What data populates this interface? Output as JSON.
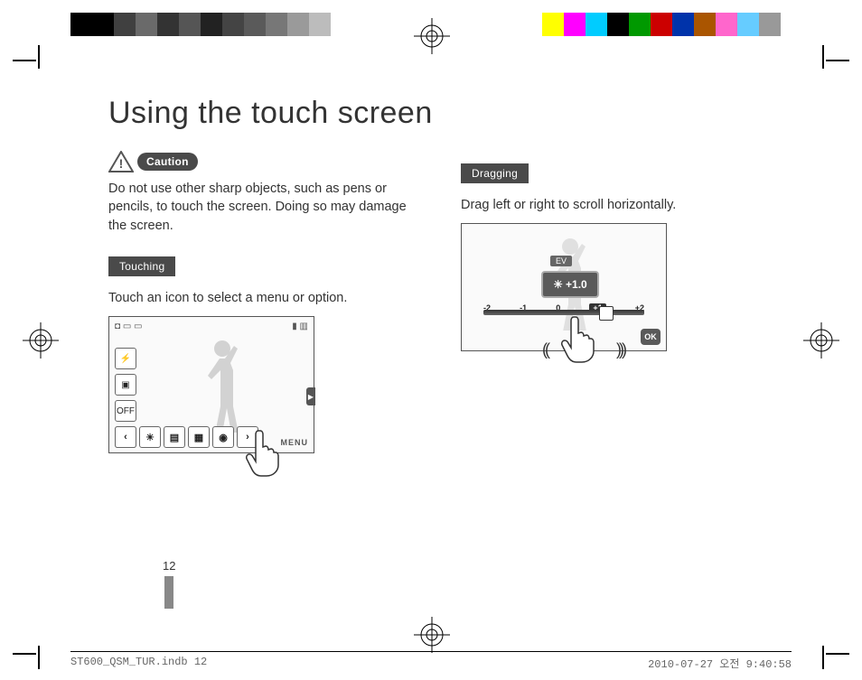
{
  "title": "Using the touch screen",
  "caution": {
    "badge": "Caution",
    "text": "Do not use other sharp objects, such as pens or pencils, to touch the screen. Doing so may damage the screen."
  },
  "sections": {
    "touching": {
      "label": "Touching",
      "text": "Touch an icon to select a menu or option."
    },
    "dragging": {
      "label": "Dragging",
      "text": "Drag left or right to scroll horizontally."
    }
  },
  "illustration_touching": {
    "menu_label": "MENU",
    "side_icons_bottom": "OFF"
  },
  "illustration_dragging": {
    "ev_title": "EV",
    "ev_value": "+1.0",
    "ticks": [
      "-2",
      "-1",
      "0",
      "+1",
      "+2"
    ],
    "ok_label": "OK"
  },
  "page_number": "12",
  "footer": {
    "file": "ST600_QSM_TUR.indb   12",
    "timestamp": "2010-07-27   오전 9:40:58"
  },
  "colorbar_left": [
    "#000",
    "#000",
    "#404040",
    "#6a6a6a",
    "#333",
    "#555",
    "#222",
    "#444",
    "#5a5a5a",
    "#777",
    "#9a9a9a",
    "#bcbcbc",
    "#fff"
  ],
  "colorbar_right": [
    "#ff0",
    "#f0f",
    "#0cf",
    "#000",
    "#090",
    "#c00",
    "#03a",
    "#a50",
    "#f6c",
    "#6cf",
    "#999"
  ]
}
